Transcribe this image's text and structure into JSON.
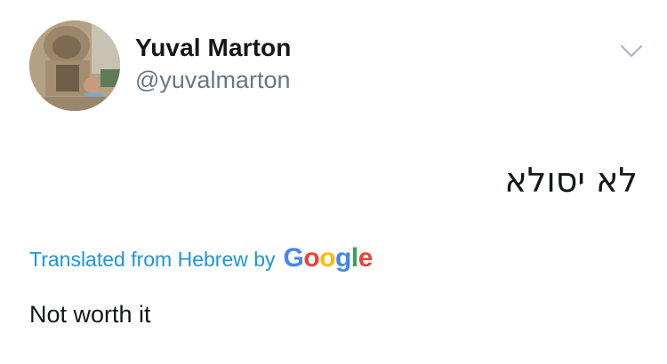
{
  "tweet": {
    "author": {
      "display_name": "Yuval Marton",
      "handle": "@yuvalmarton"
    },
    "text": "לא יסולא",
    "translation": {
      "label": "Translated from Hebrew by",
      "provider": "Google",
      "text": "Not worth it"
    },
    "icons": {
      "menu": "chevron-down-icon"
    },
    "colors": {
      "link": "#1b95e0",
      "handle": "#657786",
      "text": "#14171a",
      "google_blue": "#4285f4",
      "google_red": "#ea4335",
      "google_yellow": "#fbbc05",
      "google_green": "#34a853"
    }
  }
}
